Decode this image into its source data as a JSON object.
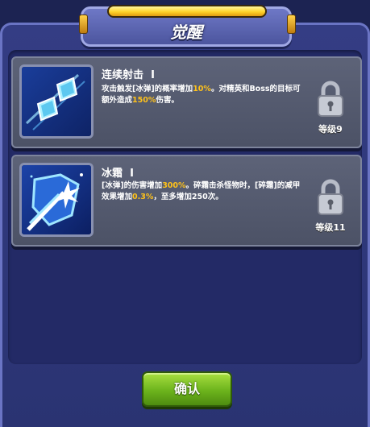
{
  "dialog": {
    "title": "觉醒"
  },
  "skills": [
    {
      "name": "连续射击",
      "level_mark": "I",
      "desc_segments": [
        {
          "t": "攻击触发[冰弹]的概率增加",
          "hl": false
        },
        {
          "t": "10%",
          "hl": true
        },
        {
          "t": "。对精英和Boss的目标可额外造成",
          "hl": false
        },
        {
          "t": "150%",
          "hl": true
        },
        {
          "t": "伤害。",
          "hl": false
        }
      ],
      "lock_label": "等级9",
      "icon": "ice-crystal-shards-icon"
    },
    {
      "name": "冰霜",
      "level_mark": "I",
      "desc_segments": [
        {
          "t": "[冰弹]的伤害增加",
          "hl": false
        },
        {
          "t": "300%",
          "hl": true
        },
        {
          "t": "。碎霜击杀怪物时，[碎霜]的减甲效果增加",
          "hl": false
        },
        {
          "t": "0.3%",
          "hl": true
        },
        {
          "t": "，至多增加250次。",
          "hl": false
        }
      ],
      "lock_label": "等级11",
      "icon": "ice-shield-burst-icon"
    }
  ],
  "confirm_label": "确认",
  "colors": {
    "highlight": "#ffc21a",
    "confirm": "#6cb31c"
  }
}
